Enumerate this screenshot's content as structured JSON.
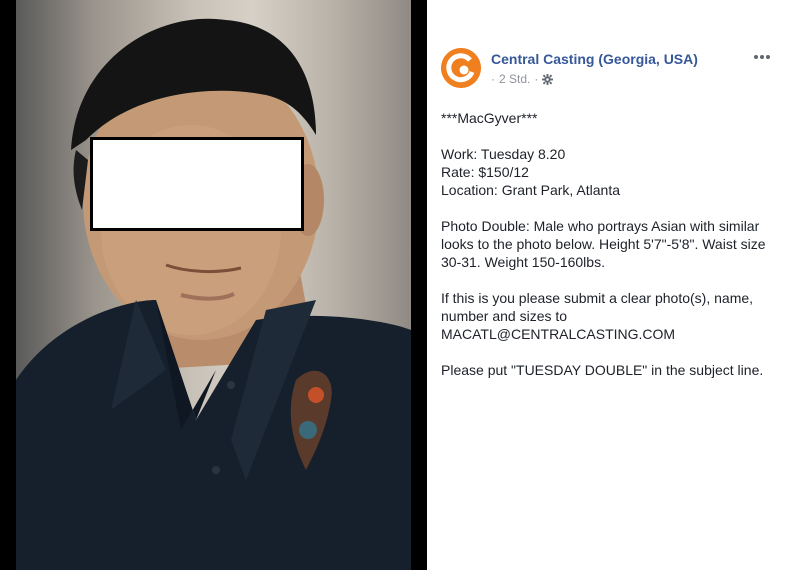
{
  "page": {
    "name": "Central Casting (Georgia, USA)",
    "timestamp": "2 Std.",
    "meta_separator": "·",
    "accent_color": "#f07f1f",
    "link_color": "#365899"
  },
  "icons": {
    "avatar": "central-casting-logo",
    "privacy": "gear-icon",
    "more": "more-options-icon"
  },
  "post": {
    "title": "***MacGyver***",
    "work": "Work: Tuesday 8.20",
    "rate": "Rate: $150/12",
    "location": "Location: Grant Park, Atlanta",
    "description_line1": "Photo Double: Male who portrays Asian with similar",
    "description_line2": "looks to the photo below. Height 5'7\"-5'8\". Waist size",
    "description_line3": "30-31. Weight 150-160lbs.",
    "submit_line1": "If this is you please submit a clear photo(s), name,",
    "submit_line2": "number and sizes to",
    "email": "MACATL@CENTRALCASTING.COM",
    "subject_line": "Please put \"TUESDAY DOUBLE\" in the subject line."
  }
}
